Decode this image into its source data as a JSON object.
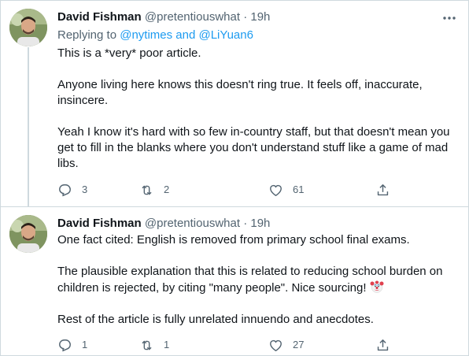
{
  "tweets": [
    {
      "author_name": "David Fishman",
      "author_handle": "@pretentiouswhat",
      "separator": "·",
      "time": "19h",
      "replying_prefix": "Replying to ",
      "replying_users": "@nytimes and @LiYuan6",
      "paragraphs": [
        "This is a *very* poor article.",
        "Anyone living here knows this doesn't ring true. It feels off, inaccurate, insincere.",
        "Yeah I know it's hard with so few in-country staff, but that doesn't mean you get to fill in the blanks where you don't understand stuff like a game of mad libs."
      ],
      "replies": "3",
      "retweets": "2",
      "likes": "61"
    },
    {
      "author_name": "David Fishman",
      "author_handle": "@pretentiouswhat",
      "separator": "·",
      "time": "19h",
      "paragraphs": [
        "One fact cited: English is removed from primary school final exams.",
        "The plausible explanation that this is related to reducing school burden on children is rejected, by citing \"many people\". Nice sourcing!",
        "Rest of the article is fully unrelated innuendo and anecdotes."
      ],
      "emoji": "clown-face",
      "replies": "1",
      "retweets": "1",
      "likes": "27"
    }
  ],
  "icons": {
    "more": "more-horizontal-icon",
    "reply": "reply-icon",
    "retweet": "retweet-icon",
    "like": "heart-icon",
    "share": "share-icon"
  },
  "colors": {
    "text": "#0f1419",
    "secondary": "#536471",
    "link": "#1d9bf0",
    "border": "#cfd9de"
  }
}
